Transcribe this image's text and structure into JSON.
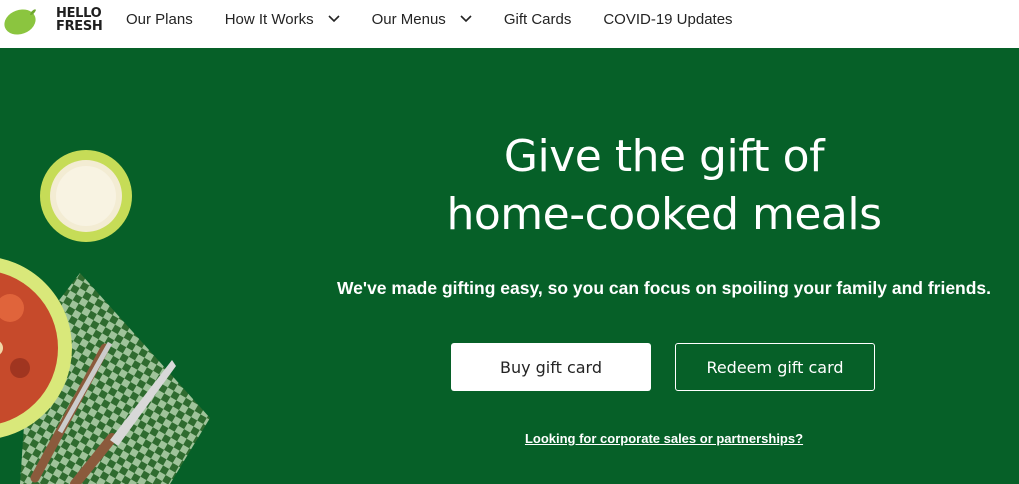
{
  "brand": {
    "logo_text": "HELLO FRESH",
    "logo_line1": "HELLO",
    "logo_line2": "FRESH",
    "lime_color": "#8bc53f"
  },
  "nav": {
    "items": [
      {
        "label": "Our Plans",
        "dropdown": false
      },
      {
        "label": "How It Works",
        "dropdown": true
      },
      {
        "label": "Our Menus",
        "dropdown": true
      },
      {
        "label": "Gift Cards",
        "dropdown": false
      },
      {
        "label": "COVID-19 Updates",
        "dropdown": false
      }
    ]
  },
  "hero": {
    "background_color": "#066028",
    "headline_line1": "Give the gift of",
    "headline_line2": "home-cooked meals",
    "subtext": "We've made gifting easy, so you can focus on spoiling your family and friends.",
    "buy_button": "Buy gift card",
    "redeem_button": "Redeem gift card",
    "corporate_link": "Looking for corporate sales or partnerships?"
  }
}
